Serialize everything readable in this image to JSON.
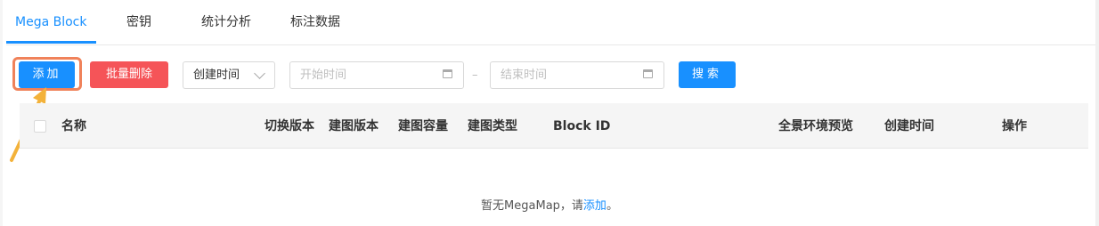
{
  "tabs": [
    {
      "label": "Mega Block",
      "active": true
    },
    {
      "label": "密钥",
      "active": false
    },
    {
      "label": "统计分析",
      "active": false
    },
    {
      "label": "标注数据",
      "active": false
    }
  ],
  "toolbar": {
    "add_label": "添加",
    "batch_delete_label": "批量删除",
    "sort_select_value": "创建时间",
    "start_date_placeholder": "开始时间",
    "separator": "–",
    "end_date_placeholder": "结束时间",
    "search_label": "搜索"
  },
  "table": {
    "columns": [
      "名称",
      "切换版本",
      "建图版本",
      "建图容量",
      "建图类型",
      "Block ID",
      "全景环境预览",
      "创建时间",
      "操作"
    ]
  },
  "empty_state": {
    "prefix": "暂无MegaMap，请",
    "link": "添加",
    "suffix": "。"
  },
  "colors": {
    "primary": "#1890ff",
    "danger": "#f55458",
    "highlight": "#f0825a",
    "arrow": "#f3b23a"
  }
}
